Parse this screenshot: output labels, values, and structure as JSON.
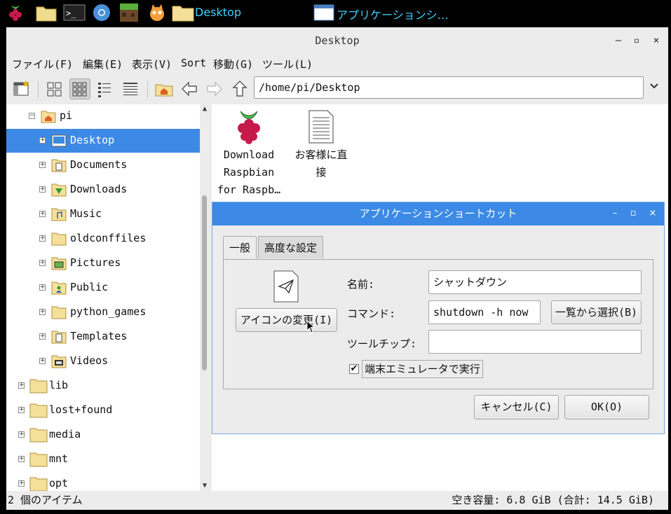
{
  "taskbar": {
    "items": [
      {
        "icon": "raspberry-menu-icon"
      },
      {
        "icon": "file-manager-icon"
      },
      {
        "icon": "terminal-icon"
      },
      {
        "icon": "chromium-icon"
      },
      {
        "icon": "minecraft-icon"
      },
      {
        "icon": "scratch-icon"
      }
    ],
    "folder_label": "Desktop",
    "window_label": "アプリケーションシ…"
  },
  "window": {
    "title": "Desktop",
    "controls": {
      "minimize": "–",
      "maximize": "▫",
      "close": "×"
    }
  },
  "menubar": [
    "ファイル(F)",
    "編集(E)",
    "表示(V)",
    "Sort",
    "移動(G)",
    "ツール(L)"
  ],
  "toolbar": {
    "path": "/home/pi/Desktop",
    "buttons": [
      "new-window-icon",
      "icon-view-icon",
      "thumbnail-view-icon",
      "compact-view-icon",
      "detailed-list-icon",
      "home-icon",
      "back-arrow-icon",
      "forward-arrow-icon",
      "up-arrow-icon"
    ]
  },
  "tree": {
    "root": {
      "label": "pi",
      "expander": "⊟"
    },
    "children": [
      {
        "label": "Desktop",
        "selected": true,
        "icon": "desktop-folder-icon"
      },
      {
        "label": "Documents",
        "icon": "documents-folder-icon"
      },
      {
        "label": "Downloads",
        "icon": "downloads-folder-icon"
      },
      {
        "label": "Music",
        "icon": "music-folder-icon"
      },
      {
        "label": "oldconffiles",
        "icon": "folder-icon"
      },
      {
        "label": "Pictures",
        "icon": "pictures-folder-icon"
      },
      {
        "label": "Public",
        "icon": "public-folder-icon"
      },
      {
        "label": "python_games",
        "icon": "folder-icon"
      },
      {
        "label": "Templates",
        "icon": "templates-folder-icon"
      },
      {
        "label": "Videos",
        "icon": "videos-folder-icon"
      }
    ],
    "top_level": [
      {
        "label": "lib"
      },
      {
        "label": "lost+found"
      },
      {
        "label": "media"
      },
      {
        "label": "mnt"
      },
      {
        "label": "opt"
      }
    ]
  },
  "files": [
    {
      "label_lines": [
        "Download",
        "Raspbian",
        "for Raspb…"
      ],
      "icon": "raspberry-icon"
    },
    {
      "label_lines": [
        "お客様に直",
        "接"
      ],
      "icon": "text-file-icon"
    }
  ],
  "status": {
    "left": "2 個のアイテム",
    "right": "空き容量: 6.8 GiB (合計: 14.5 GiB)"
  },
  "dialog": {
    "title": "アプリケーションショートカット",
    "tabs": [
      "一般",
      "高度な設定"
    ],
    "change_icon_button": "アイコンの変更(I)",
    "name_label": "名前:",
    "name_value": "シャットダウン",
    "command_label": "コマンド:",
    "command_value": "shutdown -h now",
    "select_button": "一覧から選択(B)",
    "tooltip_label": "ツールチップ:",
    "tooltip_value": "",
    "terminal_checkbox_label": "端末エミュレータで実行",
    "terminal_checked": true,
    "cancel_button": "キャンセル(C)",
    "ok_button": "OK(O)"
  },
  "colors": {
    "selection": "#3c8ae5",
    "taskbar_text": "#3fd0ff",
    "folder": "#f5e09a"
  }
}
